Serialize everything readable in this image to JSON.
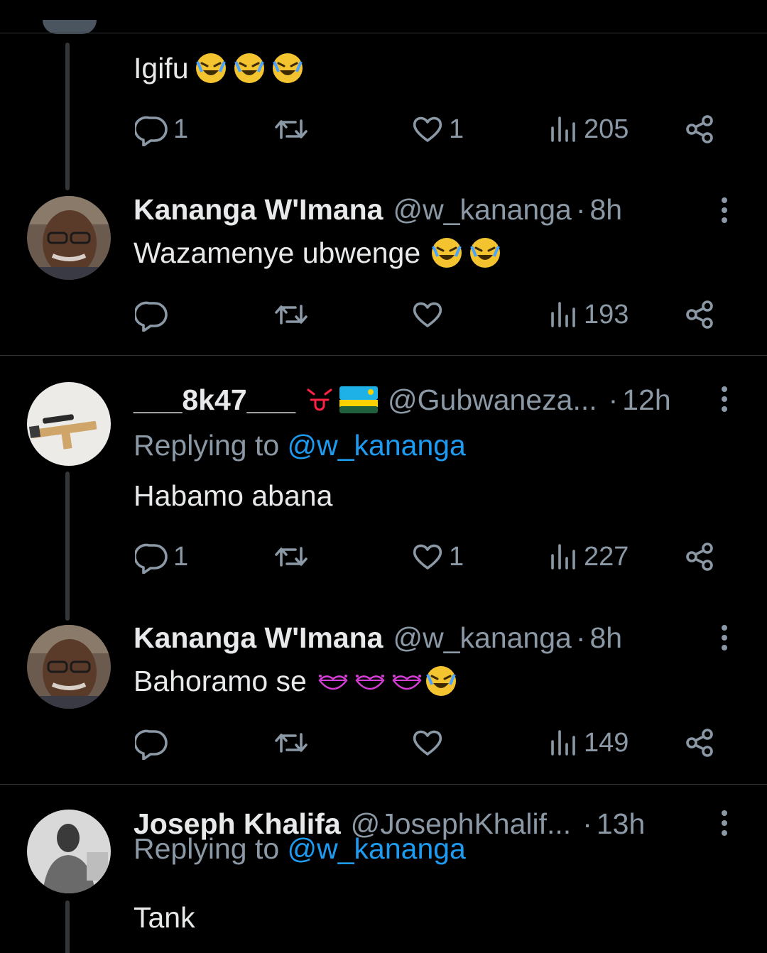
{
  "tweets": [
    {
      "text": "Igifu",
      "emoji": [
        "rofl",
        "rofl",
        "rofl"
      ],
      "replies": "1",
      "likes": "1",
      "views": "205"
    },
    {
      "name": "Kananga W'Imana",
      "handle": "@w_kananga",
      "dot": "·",
      "time": "8h",
      "text": "Wazamenye ubwenge",
      "emoji": [
        "rofl",
        "rofl"
      ],
      "replies": "",
      "likes": "",
      "views": "193"
    },
    {
      "name": "___8k47___",
      "handle": "@Gubwaneza...",
      "dot": "·",
      "time": "12h",
      "replying_prefix": "Replying to ",
      "replying_to": "@w_kananga",
      "text": "Habamo abana",
      "replies": "1",
      "likes": "1",
      "views": "227"
    },
    {
      "name": "Kananga W'Imana",
      "handle": "@w_kananga",
      "dot": "·",
      "time": "8h",
      "text": "Bahoramo se",
      "emoji": [
        "kiss-lips",
        "kiss-lips",
        "kiss-lips",
        "rofl"
      ],
      "replies": "",
      "likes": "",
      "views": "149"
    },
    {
      "name": "Joseph Khalifa",
      "handle": "@JosephKhalif...",
      "dot": "·",
      "time": "13h",
      "replying_prefix": "Replying to ",
      "replying_to": "@w_kananga",
      "text": "Tank"
    }
  ],
  "colors": {
    "background": "#000000",
    "text": "#e7e9ea",
    "muted": "#8b98a5",
    "link": "#1d9bf0",
    "divider": "#2f3336"
  },
  "icons": [
    "reply-icon",
    "retweet-icon",
    "like-icon",
    "views-icon",
    "share-icon",
    "more-icon"
  ]
}
